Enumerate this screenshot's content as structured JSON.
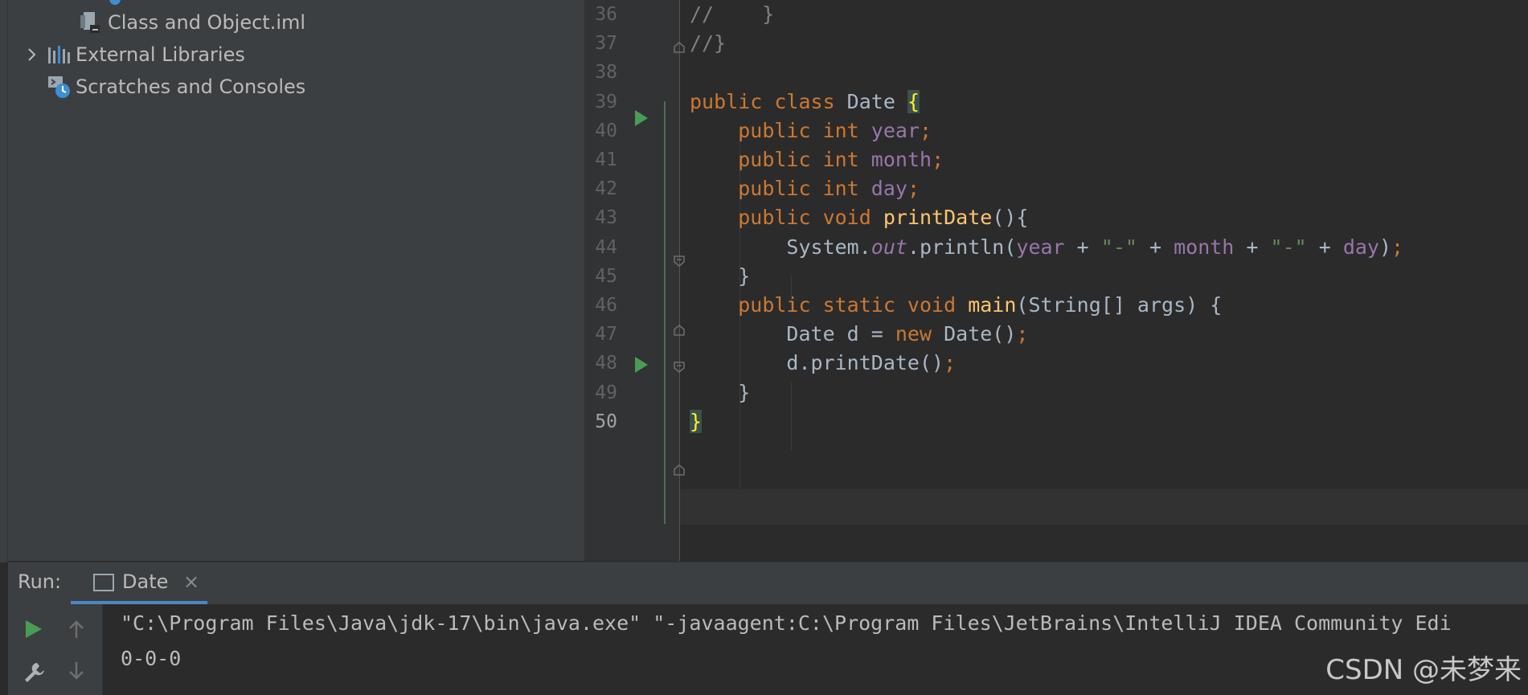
{
  "project_tree": [
    {
      "label": "Class and Object.iml",
      "icon": "iml-file-icon"
    },
    {
      "label": "External Libraries",
      "icon": "libraries-icon",
      "expandable": true
    },
    {
      "label": "Scratches and Consoles",
      "icon": "scratches-icon"
    }
  ],
  "editor": {
    "lines": [
      {
        "no": "36",
        "tokens": [
          [
            "cmt",
            "//    }"
          ]
        ]
      },
      {
        "no": "37",
        "tokens": [
          [
            "cmt",
            "//}"
          ]
        ]
      },
      {
        "no": "38",
        "tokens": []
      },
      {
        "no": "39",
        "tokens": [
          [
            "kw",
            "public class "
          ],
          [
            "plain",
            "Date "
          ],
          [
            "brace",
            "{"
          ]
        ]
      },
      {
        "no": "40",
        "tokens": [
          [
            "plain",
            "    "
          ],
          [
            "kw",
            "public int "
          ],
          [
            "fld",
            "year"
          ],
          [
            "semi",
            ";"
          ]
        ]
      },
      {
        "no": "41",
        "tokens": [
          [
            "plain",
            "    "
          ],
          [
            "kw",
            "public int "
          ],
          [
            "fld",
            "month"
          ],
          [
            "semi",
            ";"
          ]
        ]
      },
      {
        "no": "42",
        "tokens": [
          [
            "plain",
            "    "
          ],
          [
            "kw",
            "public int "
          ],
          [
            "fld",
            "day"
          ],
          [
            "semi",
            ";"
          ]
        ]
      },
      {
        "no": "43",
        "tokens": [
          [
            "plain",
            "    "
          ],
          [
            "kw",
            "public void "
          ],
          [
            "mth",
            "printDate"
          ],
          [
            "plain",
            "(){"
          ]
        ]
      },
      {
        "no": "44",
        "tokens": [
          [
            "plain",
            "        System."
          ],
          [
            "stat",
            "out"
          ],
          [
            "plain",
            ".println("
          ],
          [
            "fld",
            "year"
          ],
          [
            "plain",
            " + "
          ],
          [
            "str",
            "\"-\""
          ],
          [
            "plain",
            " + "
          ],
          [
            "fld",
            "month"
          ],
          [
            "plain",
            " + "
          ],
          [
            "str",
            "\"-\""
          ],
          [
            "plain",
            " + "
          ],
          [
            "fld",
            "day"
          ],
          [
            "plain",
            ")"
          ],
          [
            "semi",
            ";"
          ]
        ]
      },
      {
        "no": "45",
        "tokens": [
          [
            "plain",
            "    }"
          ]
        ]
      },
      {
        "no": "46",
        "tokens": [
          [
            "plain",
            "    "
          ],
          [
            "kw",
            "public static void "
          ],
          [
            "mth",
            "main"
          ],
          [
            "plain",
            "(String[] args) {"
          ]
        ]
      },
      {
        "no": "47",
        "tokens": [
          [
            "plain",
            "        Date d = "
          ],
          [
            "kw",
            "new "
          ],
          [
            "plain",
            "Date()"
          ],
          [
            "semi",
            ";"
          ]
        ]
      },
      {
        "no": "48",
        "tokens": [
          [
            "plain",
            "        d.printDate()"
          ],
          [
            "semi",
            ";"
          ]
        ]
      },
      {
        "no": "49",
        "tokens": [
          [
            "plain",
            "    }"
          ]
        ]
      },
      {
        "no": "50",
        "tokens": [
          [
            "brace",
            "}"
          ]
        ]
      }
    ]
  },
  "run_panel": {
    "label": "Run:",
    "tab_label": "Date",
    "close_glyph": "×",
    "console_lines": [
      "\"C:\\Program Files\\Java\\jdk-17\\bin\\java.exe\" \"-javaagent:C:\\Program Files\\JetBrains\\IntelliJ IDEA Community Edi",
      "0-0-0"
    ]
  },
  "watermark": "CSDN @未梦来",
  "colors": {
    "keyword": "#cc7832",
    "field": "#9876aa",
    "method": "#ffc66d",
    "string": "#6a8759",
    "run_green": "#499c54",
    "tab_underline": "#4a88c7"
  }
}
